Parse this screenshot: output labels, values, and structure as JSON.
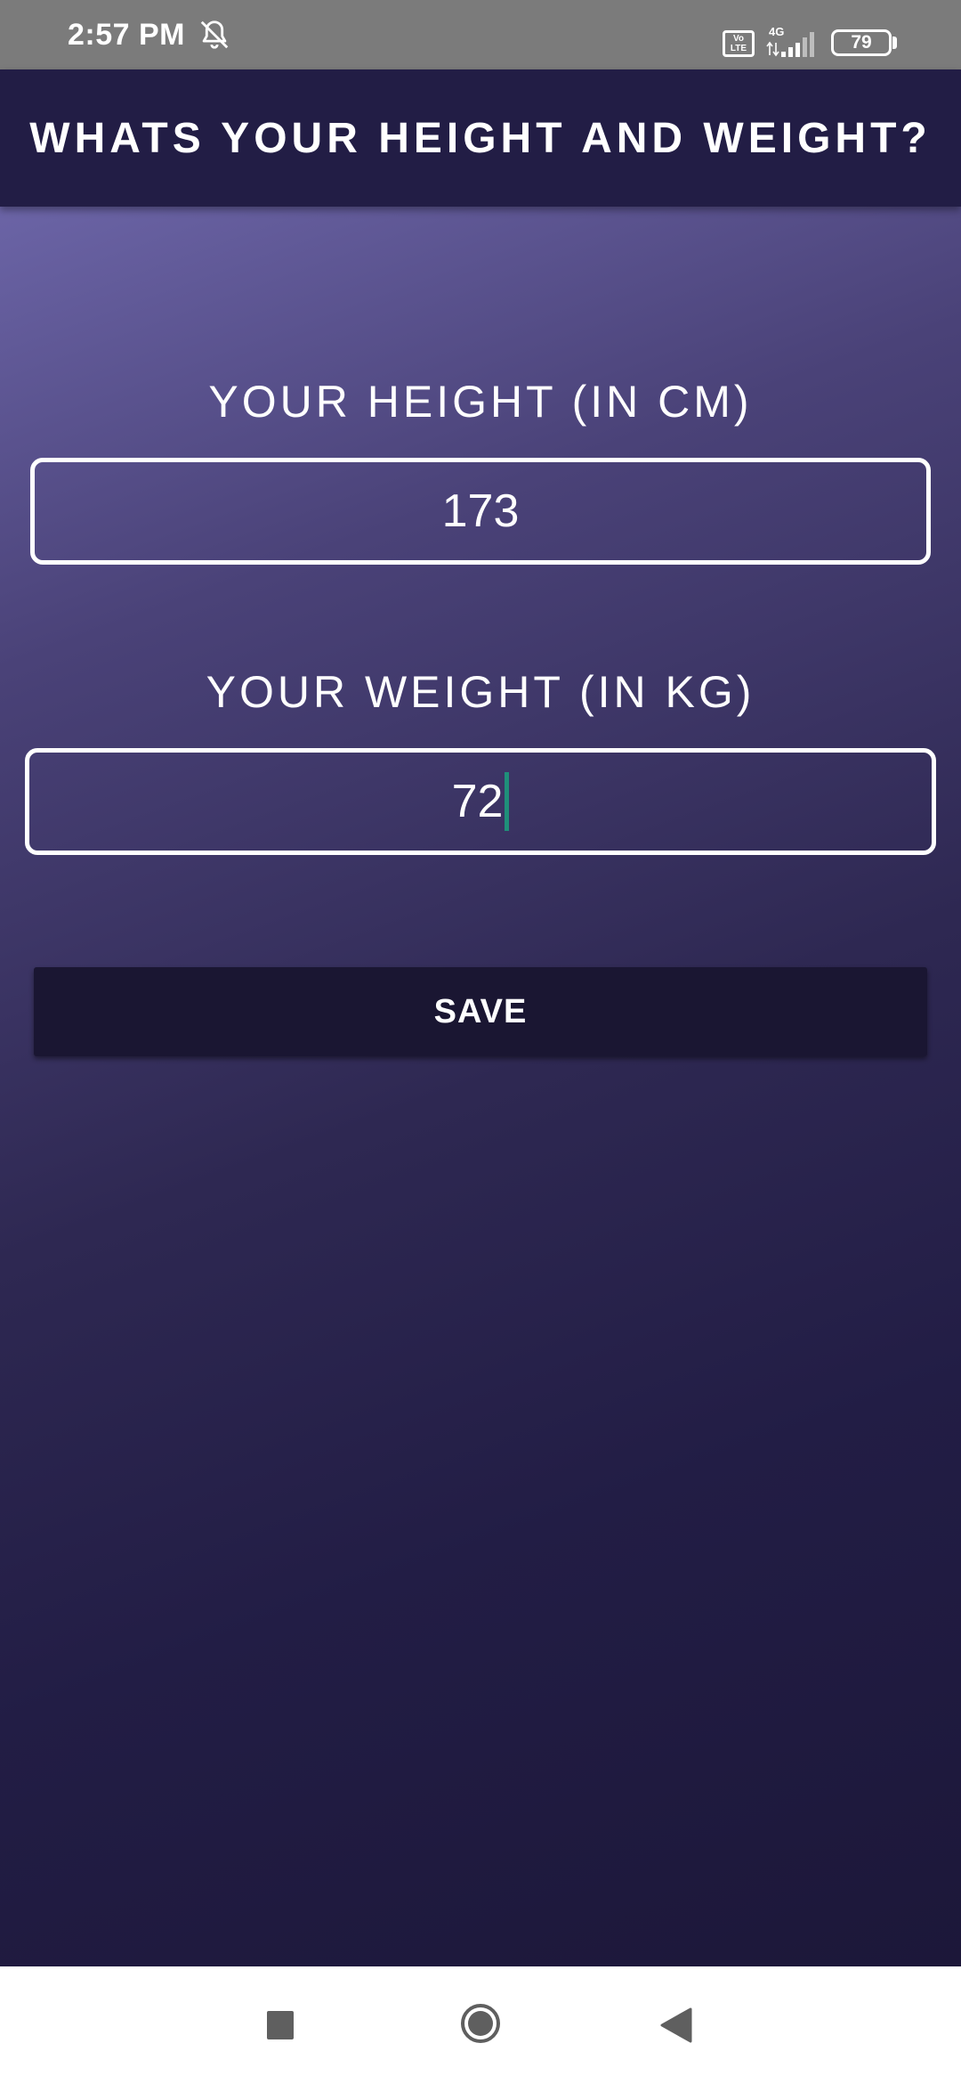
{
  "status_bar": {
    "time": "2:57 PM",
    "volte": "Vo LTE",
    "network": "4G",
    "battery": "79",
    "icons": [
      "bell-off-icon",
      "volte-icon",
      "signal-icon",
      "battery-icon"
    ]
  },
  "app_bar": {
    "title": "WHATS YOUR HEIGHT AND WEIGHT?"
  },
  "form": {
    "height_label": "YOUR HEIGHT (IN CM)",
    "height_value": "173",
    "weight_label": "YOUR WEIGHT (IN KG)",
    "weight_value": "72",
    "save_label": "SAVE"
  },
  "nav_bar": {
    "icons": [
      "recents-icon",
      "home-icon",
      "back-icon"
    ]
  },
  "colors": {
    "app_bar": "#221d45",
    "gradient_top": "#6b64a6",
    "gradient_bottom": "#1c1739",
    "button": "#1a1632",
    "caret": "#1f8f7a"
  }
}
